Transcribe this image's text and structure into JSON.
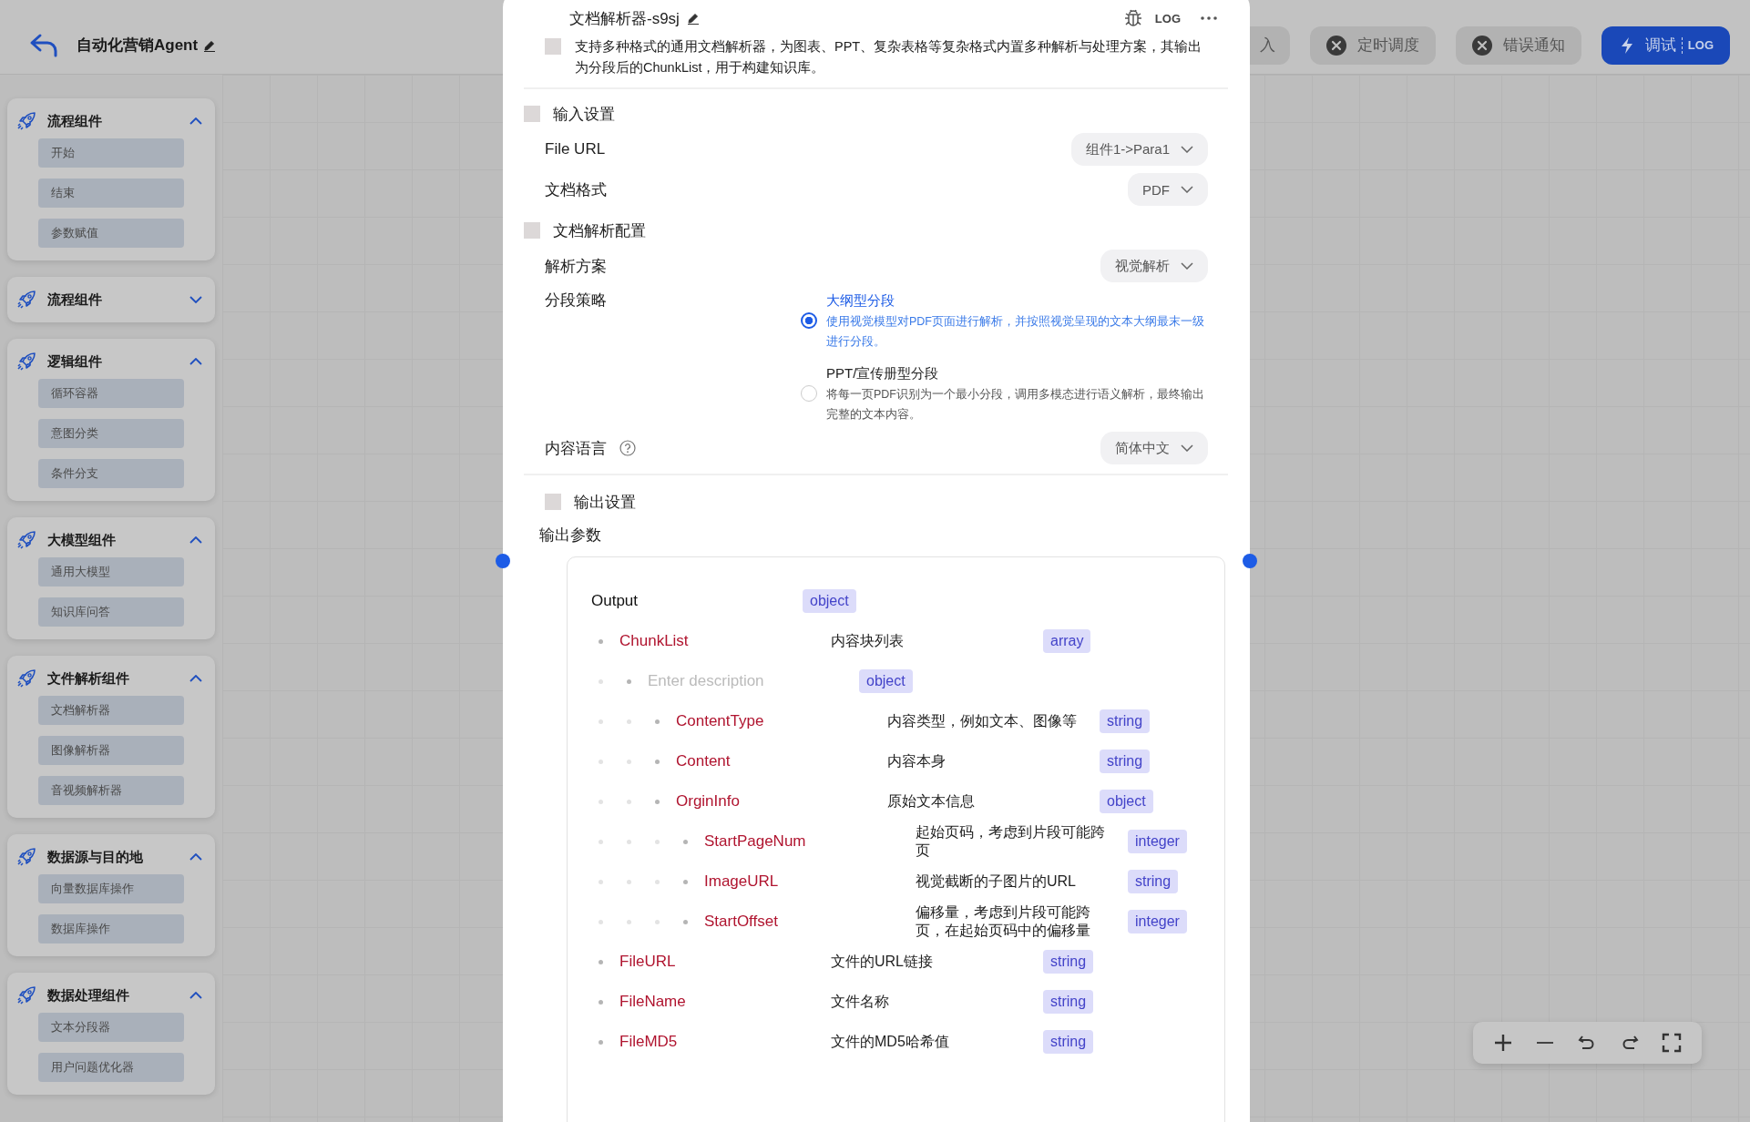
{
  "app_bar": {
    "title": "自动化营销Agent",
    "buttons": [
      {
        "label": "入",
        "kind": "plain"
      },
      {
        "label": "定时调度",
        "kind": "off"
      },
      {
        "label": "错误通知",
        "kind": "off"
      },
      {
        "label": "调试",
        "badge": "LOG",
        "kind": "primary"
      }
    ]
  },
  "sidebar": {
    "groups": [
      {
        "title": "流程组件",
        "expanded": true,
        "items": [
          "开始",
          "结束",
          "参数赋值"
        ]
      },
      {
        "title": "流程组件",
        "expanded": false
      },
      {
        "title": "逻辑组件",
        "expanded": true,
        "items": [
          "循环容器",
          "意图分类",
          "条件分支"
        ]
      },
      {
        "title": "大模型组件",
        "expanded": true,
        "items": [
          "通用大模型",
          "知识库问答"
        ]
      },
      {
        "title": "文件解析组件",
        "expanded": true,
        "items": [
          "文档解析器",
          "图像解析器",
          "音视频解析器"
        ]
      },
      {
        "title": "数据源与目的地",
        "expanded": true,
        "items": [
          "向量数据库操作",
          "数据库操作"
        ]
      },
      {
        "title": "数据处理组件",
        "expanded": true,
        "items": [
          "文本分段器",
          "用户问题优化器"
        ]
      }
    ]
  },
  "node": {
    "title": "文档解析器-s9sj",
    "log_label": "LOG",
    "description": "支持多种格式的通用文档解析器，为图表、PPT、复杂表格等复杂格式内置多种解析与处理方案，其输出为分段后的ChunkList，用于构建知识库。",
    "sections": [
      {
        "title": "输入设置",
        "fields": [
          {
            "label": "File URL",
            "kind": "select",
            "value": "组件1->Para1"
          },
          {
            "label": "文档格式",
            "kind": "select",
            "value": "PDF"
          }
        ]
      },
      {
        "title": "文档解析配置",
        "fields": [
          {
            "label": "解析方案",
            "kind": "select",
            "value": "视觉解析"
          },
          {
            "label": "分段策略",
            "kind": "radio",
            "options": [
              {
                "title": "大纲型分段",
                "description": "使用视觉模型对PDF页面进行解析，并按照视觉呈现的文本大纲最末一级进行分段。",
                "selected": true
              },
              {
                "title": "PPT/宣传册型分段",
                "description": "将每一页PDF识别为一个最小分段，调用多模态进行语义解析，最终输出完整的文本内容。",
                "selected": false
              }
            ]
          },
          {
            "label": "内容语言",
            "kind": "select",
            "value": "简体中文",
            "help": true
          }
        ]
      }
    ],
    "output_section": {
      "title": "输出设置",
      "params_label": "输出参数",
      "root": {
        "name": "Output",
        "type": "object"
      },
      "fields": [
        {
          "name": "ChunkList",
          "description": "内容块列表",
          "type": "array",
          "children": [
            {
              "placeholder": "Enter description",
              "type": "object",
              "children": [
                {
                  "name": "ContentType",
                  "description": "内容类型，例如文本、图像等",
                  "type": "string"
                },
                {
                  "name": "Content",
                  "description": "内容本身",
                  "type": "string"
                },
                {
                  "name": "OrginInfo",
                  "description": "原始文本信息",
                  "type": "object",
                  "children": [
                    {
                      "name": "StartPageNum",
                      "description": "起始页码，考虑到片段可能跨页",
                      "type": "integer"
                    },
                    {
                      "name": "ImageURL",
                      "description": "视觉截断的子图片的URL",
                      "type": "string"
                    },
                    {
                      "name": "StartOffset",
                      "description": "偏移量，考虑到片段可能跨页，在起始页码中的偏移量",
                      "type": "integer"
                    }
                  ]
                }
              ]
            }
          ]
        },
        {
          "name": "FileURL",
          "description": "文件的URL链接",
          "type": "string"
        },
        {
          "name": "FileName",
          "description": "文件名称",
          "type": "string"
        },
        {
          "name": "FileMD5",
          "description": "文件的MD5哈希值",
          "type": "string"
        }
      ]
    }
  }
}
